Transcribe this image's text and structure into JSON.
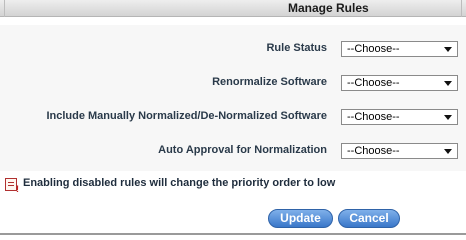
{
  "dialog": {
    "title": "Manage Rules"
  },
  "fields": [
    {
      "label": "Rule Status",
      "value": "--Choose--"
    },
    {
      "label": "Renormalize Software",
      "value": "--Choose--"
    },
    {
      "label": "Include Manually Normalized/De-Normalized Software",
      "value": "--Choose--"
    },
    {
      "label": "Auto Approval for Normalization",
      "value": "--Choose--"
    }
  ],
  "note": {
    "icon": "warning-note-icon",
    "text": "Enabling disabled rules will change the priority order to low"
  },
  "buttons": {
    "update_label": "Update",
    "cancel_label": "Cancel"
  },
  "colors": {
    "button": "#3a77c9",
    "label_text": "#2a3a4a",
    "form_bg": "#f7f7f7"
  }
}
